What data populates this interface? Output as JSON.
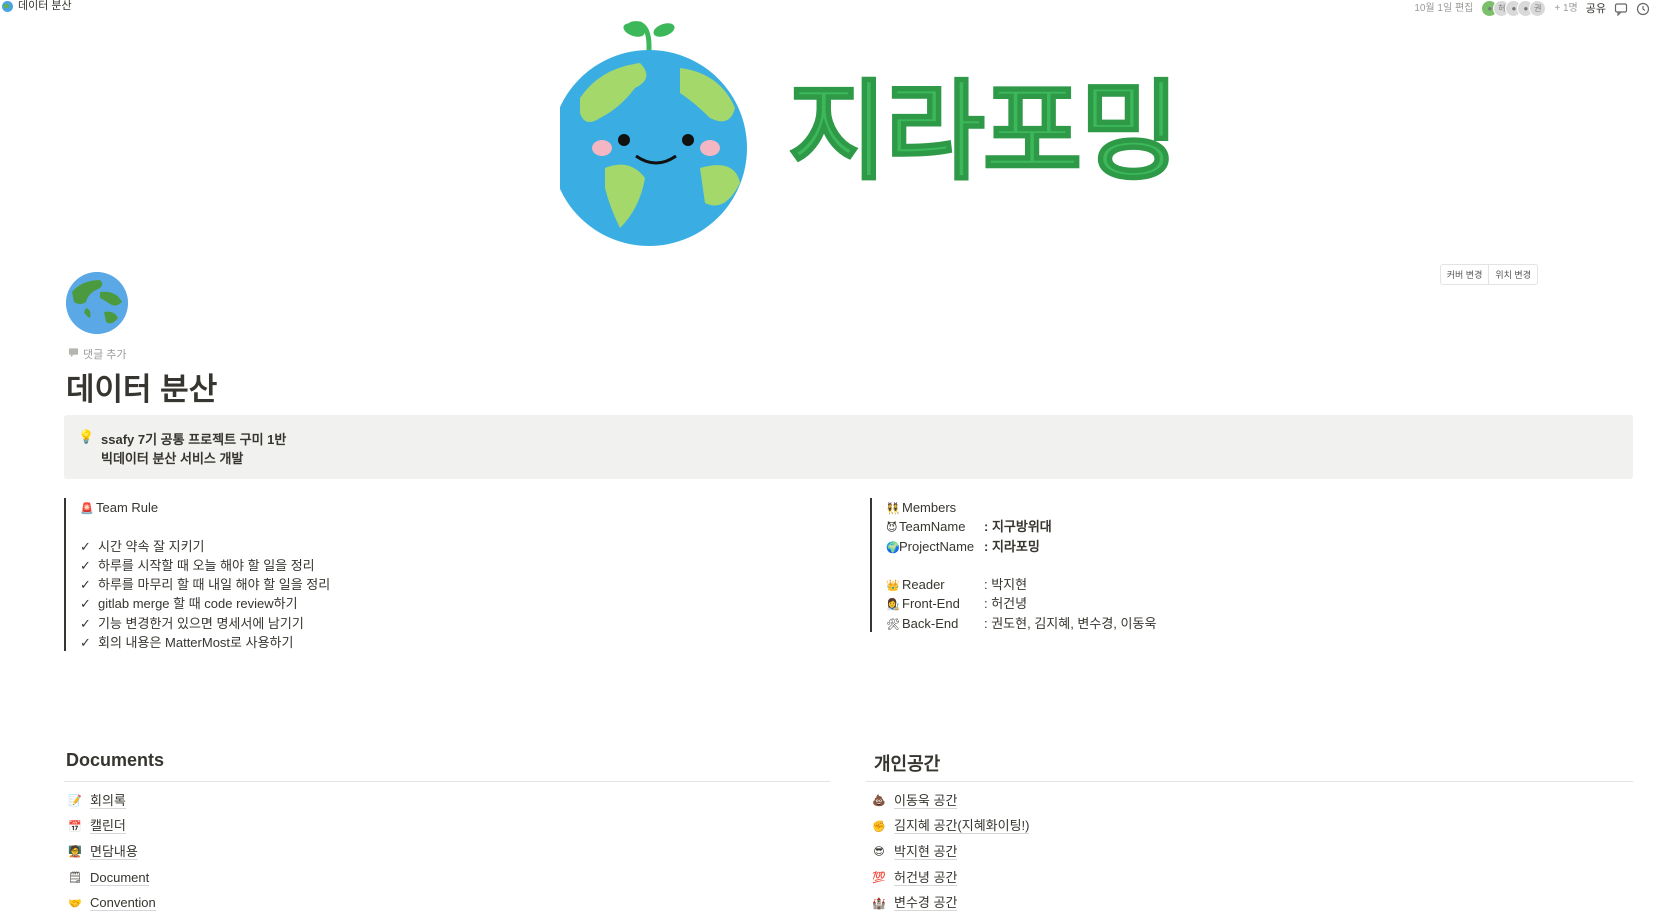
{
  "topbar": {
    "breadcrumb_title": "데이터 분산",
    "edited": "10월 1일 편집",
    "avatar_labels": [
      "허",
      "권"
    ],
    "more_members": "+ 1명",
    "share_label": "공유"
  },
  "cover": {
    "logo_text": "지라포밍",
    "change_cover_label": "커버 변경",
    "reposition_label": "위치 변경"
  },
  "page": {
    "add_comment": "댓글 추가",
    "title": "데이터 분산",
    "callout_line1": "ssafy 7기 공통 프로젝트 구미 1반",
    "callout_line2": "빅데이터 분산 서비스 개발"
  },
  "team_rule": {
    "heading": "Team Rule",
    "items": [
      "시간 약속 잘 지키기",
      "하루를 시작할 때 오늘 해야 할 일을 정리",
      "하루를 마무리 할 때 내일 해야 할 일을 정리",
      "gitlab merge 할 때 code review하기",
      "기능 변경한거 있으면 명세서에 남기기",
      "회의 내용은 MatterMost로 사용하기"
    ]
  },
  "members": {
    "heading": "Members",
    "team_name_key": "TeamName",
    "team_name_val": "지구방위대",
    "project_name_key": "ProjectName",
    "project_name_val": "지라포밍",
    "reader_key": "Reader",
    "reader_val": ": 박지현",
    "frontend_key": "Front-End",
    "frontend_val": ": 허건녕",
    "backend_key": "Back-End",
    "backend_val": ": 권도현, 김지혜, 변수경, 이동욱"
  },
  "documents": {
    "heading": "Documents",
    "items": [
      "회의록",
      "캘린더",
      "면담내용",
      "Document",
      "Convention"
    ]
  },
  "personal": {
    "heading": "개인공간",
    "items": [
      "이동욱 공간",
      "김지혜 공간(지혜화이팅!)",
      "박지현 공간",
      "허건녕 공간",
      "변수경 공간"
    ]
  },
  "colors": {
    "logo_green": "#3cb75a",
    "callout_bg": "#f1f1ef",
    "text": "#37352f",
    "muted": "#9b9a97"
  }
}
